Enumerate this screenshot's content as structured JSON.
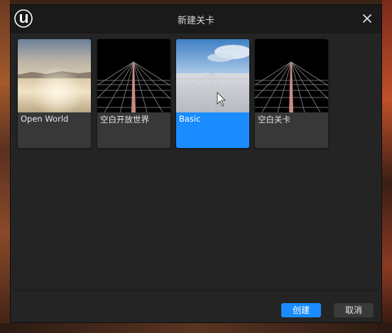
{
  "dialog": {
    "title": "新建关卡",
    "close_icon": "close-icon",
    "logo_icon": "unreal-logo-icon"
  },
  "templates": [
    {
      "label": "Open World",
      "thumbnail": "open-world-thumbnail",
      "selected": false
    },
    {
      "label": "空白开放世界",
      "thumbnail": "grid-thumbnail",
      "selected": false
    },
    {
      "label": "Basic",
      "thumbnail": "basic-thumbnail",
      "selected": true
    },
    {
      "label": "空白关卡",
      "thumbnail": "grid-thumbnail",
      "selected": false
    }
  ],
  "footer": {
    "create_label": "创建",
    "cancel_label": "取消"
  },
  "colors": {
    "accent": "#1a8cff",
    "dialog_bg": "#242424",
    "titlebar_bg": "#1a1a1a",
    "tile_bg": "#383838"
  }
}
